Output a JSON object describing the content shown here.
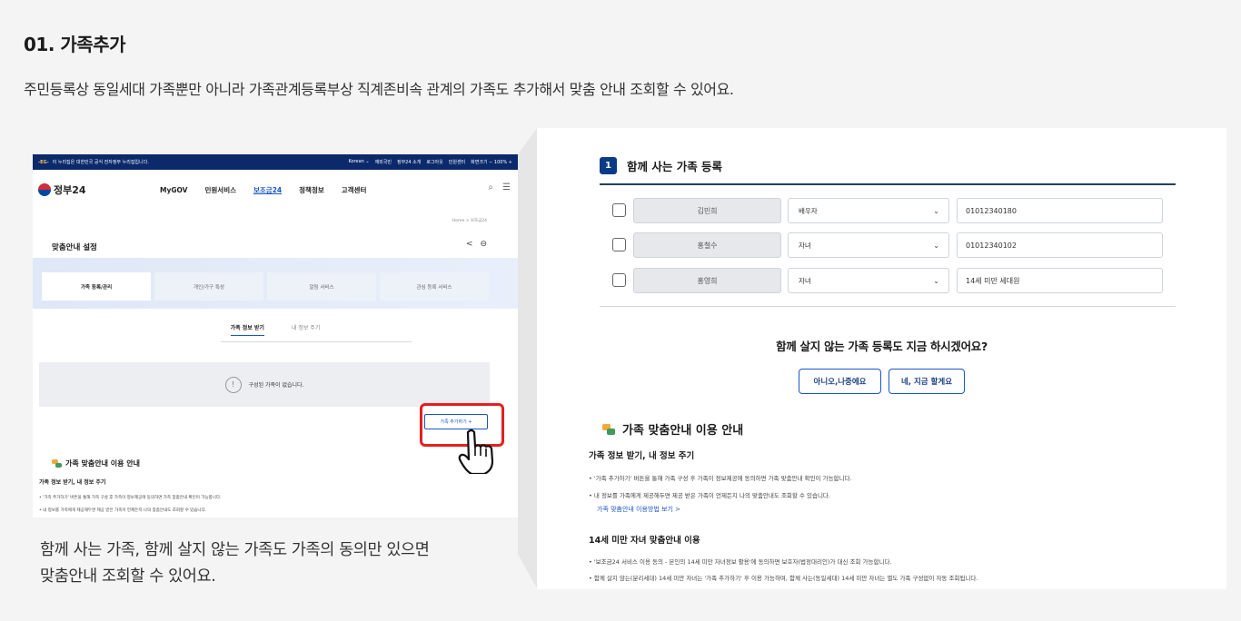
{
  "header": {
    "title": "01. 가족추가",
    "description": "주민등록상 동일세대 가족뿐만 아니라 가족관계등록부상 직계존비속 관계의 가족도 추가해서 맞춤 안내 조회할 수 있어요."
  },
  "left": {
    "topbar": {
      "notice": "이 누리집은 대한민국 공식 전자정부 누리집입니다.",
      "links": [
        "Korean ⌄",
        "재외국민",
        "정부24 소개",
        "로그아웃",
        "민원센터",
        "화면크기 − 100% +"
      ]
    },
    "logo_text": "정부24",
    "menu": [
      "MyGOV",
      "민원서비스",
      "보조금24",
      "정책정보",
      "고객센터"
    ],
    "breadcrumb": "Home > 보조금24",
    "page_title": "맞춤안내 설정",
    "tabs": [
      "가족 등록/관리",
      "개인/가구 특성",
      "알림 서비스",
      "관심 등록 서비스"
    ],
    "subtabs": [
      "가족 정보 받기",
      "내 정보 주기"
    ],
    "empty_message": "구성된 가족이 없습니다.",
    "add_button": "가족 추가하기 +",
    "guide_title": "가족 맞춤안내 이용 안내",
    "guide_sub": "가족 정보 받기, 내 정보 주기",
    "guide_bullets": [
      "• '가족 추가하기' 버튼을 통해 가족 구성 후 가족이 정보제공에 동의하면 가족 맞춤안내 확인이 가능합니다.",
      "• 내 정보를 가족에게 제공해두면 제공 받은 가족이 언제든지 나의 맞춤안내도 조회할 수 있습니다."
    ]
  },
  "caption": {
    "line1": "함께 사는 가족, 함께 살지 않는 가족도 가족의 동의만 있으면",
    "line2": "맞춤안내 조회할 수 있어요."
  },
  "right": {
    "step_number": "1",
    "step_title": "함께 사는 가족 등록",
    "rows": [
      {
        "name": "김민희",
        "relation": "배우자",
        "phone": "01012340180"
      },
      {
        "name": "홍철수",
        "relation": "자녀",
        "phone": "01012340102"
      },
      {
        "name": "홍영희",
        "relation": "자녀",
        "phone": "14세 미만 세대원"
      }
    ],
    "question": "함께 살지 않는 가족 등록도 지금 하시겠어요?",
    "btn_no": "아니오,나중에요",
    "btn_yes": "네, 지금 할게요",
    "guide_title": "가족 맞춤안내 이용 안내",
    "sub1": "가족 정보 받기, 내 정보 주기",
    "bullets1": [
      "• '가족 추가하기' 버튼을 통해 가족 구성 후 가족이 정보제공에 동의하면 가족 맞춤안내 확인이 가능합니다.",
      "• 내 정보를 가족에게 제공해두면 제공 받은 가족이 언제든지 나의 맞춤안내도 조회할 수 있습니다."
    ],
    "link": "가족 맞춤안내 이용방법 보기 >",
    "sub2": "14세 미만 자녀 맞춤안내 이용",
    "bullets2": [
      "• '보조금24 서비스 이용 동의 - 본인의 14세 미만 자녀정보 활용'에 동의하면 보호자(법정대리인)가 대신 조회 가능합니다.",
      "• 함께 살지 않는(분리세대) 14세 미만 자녀는 '가족 추가하기' 후 이용 가능하며, 함께 사는(동일세대) 14세 미만 자녀는 별도 가족 구성없이 자동 조회됩니다."
    ]
  },
  "colors": {
    "accent": "#1a55c7",
    "navy": "#0b3a86",
    "highlight": "#e51f1f"
  }
}
